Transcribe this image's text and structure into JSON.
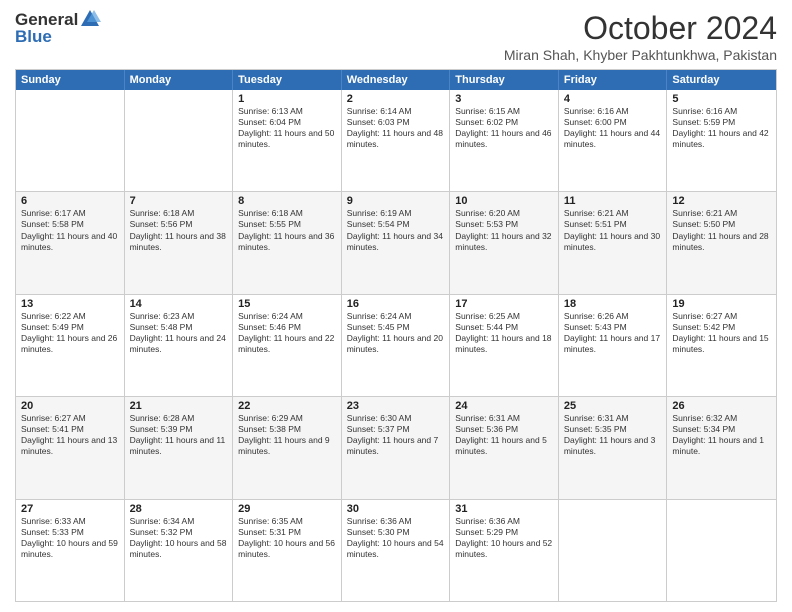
{
  "logo": {
    "line1": "General",
    "line2": "Blue"
  },
  "title": "October 2024",
  "subtitle": "Miran Shah, Khyber Pakhtunkhwa, Pakistan",
  "header_days": [
    "Sunday",
    "Monday",
    "Tuesday",
    "Wednesday",
    "Thursday",
    "Friday",
    "Saturday"
  ],
  "weeks": [
    [
      {
        "day": "",
        "sunrise": "",
        "sunset": "",
        "daylight": ""
      },
      {
        "day": "",
        "sunrise": "",
        "sunset": "",
        "daylight": ""
      },
      {
        "day": "1",
        "sunrise": "Sunrise: 6:13 AM",
        "sunset": "Sunset: 6:04 PM",
        "daylight": "Daylight: 11 hours and 50 minutes."
      },
      {
        "day": "2",
        "sunrise": "Sunrise: 6:14 AM",
        "sunset": "Sunset: 6:03 PM",
        "daylight": "Daylight: 11 hours and 48 minutes."
      },
      {
        "day": "3",
        "sunrise": "Sunrise: 6:15 AM",
        "sunset": "Sunset: 6:02 PM",
        "daylight": "Daylight: 11 hours and 46 minutes."
      },
      {
        "day": "4",
        "sunrise": "Sunrise: 6:16 AM",
        "sunset": "Sunset: 6:00 PM",
        "daylight": "Daylight: 11 hours and 44 minutes."
      },
      {
        "day": "5",
        "sunrise": "Sunrise: 6:16 AM",
        "sunset": "Sunset: 5:59 PM",
        "daylight": "Daylight: 11 hours and 42 minutes."
      }
    ],
    [
      {
        "day": "6",
        "sunrise": "Sunrise: 6:17 AM",
        "sunset": "Sunset: 5:58 PM",
        "daylight": "Daylight: 11 hours and 40 minutes."
      },
      {
        "day": "7",
        "sunrise": "Sunrise: 6:18 AM",
        "sunset": "Sunset: 5:56 PM",
        "daylight": "Daylight: 11 hours and 38 minutes."
      },
      {
        "day": "8",
        "sunrise": "Sunrise: 6:18 AM",
        "sunset": "Sunset: 5:55 PM",
        "daylight": "Daylight: 11 hours and 36 minutes."
      },
      {
        "day": "9",
        "sunrise": "Sunrise: 6:19 AM",
        "sunset": "Sunset: 5:54 PM",
        "daylight": "Daylight: 11 hours and 34 minutes."
      },
      {
        "day": "10",
        "sunrise": "Sunrise: 6:20 AM",
        "sunset": "Sunset: 5:53 PM",
        "daylight": "Daylight: 11 hours and 32 minutes."
      },
      {
        "day": "11",
        "sunrise": "Sunrise: 6:21 AM",
        "sunset": "Sunset: 5:51 PM",
        "daylight": "Daylight: 11 hours and 30 minutes."
      },
      {
        "day": "12",
        "sunrise": "Sunrise: 6:21 AM",
        "sunset": "Sunset: 5:50 PM",
        "daylight": "Daylight: 11 hours and 28 minutes."
      }
    ],
    [
      {
        "day": "13",
        "sunrise": "Sunrise: 6:22 AM",
        "sunset": "Sunset: 5:49 PM",
        "daylight": "Daylight: 11 hours and 26 minutes."
      },
      {
        "day": "14",
        "sunrise": "Sunrise: 6:23 AM",
        "sunset": "Sunset: 5:48 PM",
        "daylight": "Daylight: 11 hours and 24 minutes."
      },
      {
        "day": "15",
        "sunrise": "Sunrise: 6:24 AM",
        "sunset": "Sunset: 5:46 PM",
        "daylight": "Daylight: 11 hours and 22 minutes."
      },
      {
        "day": "16",
        "sunrise": "Sunrise: 6:24 AM",
        "sunset": "Sunset: 5:45 PM",
        "daylight": "Daylight: 11 hours and 20 minutes."
      },
      {
        "day": "17",
        "sunrise": "Sunrise: 6:25 AM",
        "sunset": "Sunset: 5:44 PM",
        "daylight": "Daylight: 11 hours and 18 minutes."
      },
      {
        "day": "18",
        "sunrise": "Sunrise: 6:26 AM",
        "sunset": "Sunset: 5:43 PM",
        "daylight": "Daylight: 11 hours and 17 minutes."
      },
      {
        "day": "19",
        "sunrise": "Sunrise: 6:27 AM",
        "sunset": "Sunset: 5:42 PM",
        "daylight": "Daylight: 11 hours and 15 minutes."
      }
    ],
    [
      {
        "day": "20",
        "sunrise": "Sunrise: 6:27 AM",
        "sunset": "Sunset: 5:41 PM",
        "daylight": "Daylight: 11 hours and 13 minutes."
      },
      {
        "day": "21",
        "sunrise": "Sunrise: 6:28 AM",
        "sunset": "Sunset: 5:39 PM",
        "daylight": "Daylight: 11 hours and 11 minutes."
      },
      {
        "day": "22",
        "sunrise": "Sunrise: 6:29 AM",
        "sunset": "Sunset: 5:38 PM",
        "daylight": "Daylight: 11 hours and 9 minutes."
      },
      {
        "day": "23",
        "sunrise": "Sunrise: 6:30 AM",
        "sunset": "Sunset: 5:37 PM",
        "daylight": "Daylight: 11 hours and 7 minutes."
      },
      {
        "day": "24",
        "sunrise": "Sunrise: 6:31 AM",
        "sunset": "Sunset: 5:36 PM",
        "daylight": "Daylight: 11 hours and 5 minutes."
      },
      {
        "day": "25",
        "sunrise": "Sunrise: 6:31 AM",
        "sunset": "Sunset: 5:35 PM",
        "daylight": "Daylight: 11 hours and 3 minutes."
      },
      {
        "day": "26",
        "sunrise": "Sunrise: 6:32 AM",
        "sunset": "Sunset: 5:34 PM",
        "daylight": "Daylight: 11 hours and 1 minute."
      }
    ],
    [
      {
        "day": "27",
        "sunrise": "Sunrise: 6:33 AM",
        "sunset": "Sunset: 5:33 PM",
        "daylight": "Daylight: 10 hours and 59 minutes."
      },
      {
        "day": "28",
        "sunrise": "Sunrise: 6:34 AM",
        "sunset": "Sunset: 5:32 PM",
        "daylight": "Daylight: 10 hours and 58 minutes."
      },
      {
        "day": "29",
        "sunrise": "Sunrise: 6:35 AM",
        "sunset": "Sunset: 5:31 PM",
        "daylight": "Daylight: 10 hours and 56 minutes."
      },
      {
        "day": "30",
        "sunrise": "Sunrise: 6:36 AM",
        "sunset": "Sunset: 5:30 PM",
        "daylight": "Daylight: 10 hours and 54 minutes."
      },
      {
        "day": "31",
        "sunrise": "Sunrise: 6:36 AM",
        "sunset": "Sunset: 5:29 PM",
        "daylight": "Daylight: 10 hours and 52 minutes."
      },
      {
        "day": "",
        "sunrise": "",
        "sunset": "",
        "daylight": ""
      },
      {
        "day": "",
        "sunrise": "",
        "sunset": "",
        "daylight": ""
      }
    ]
  ]
}
